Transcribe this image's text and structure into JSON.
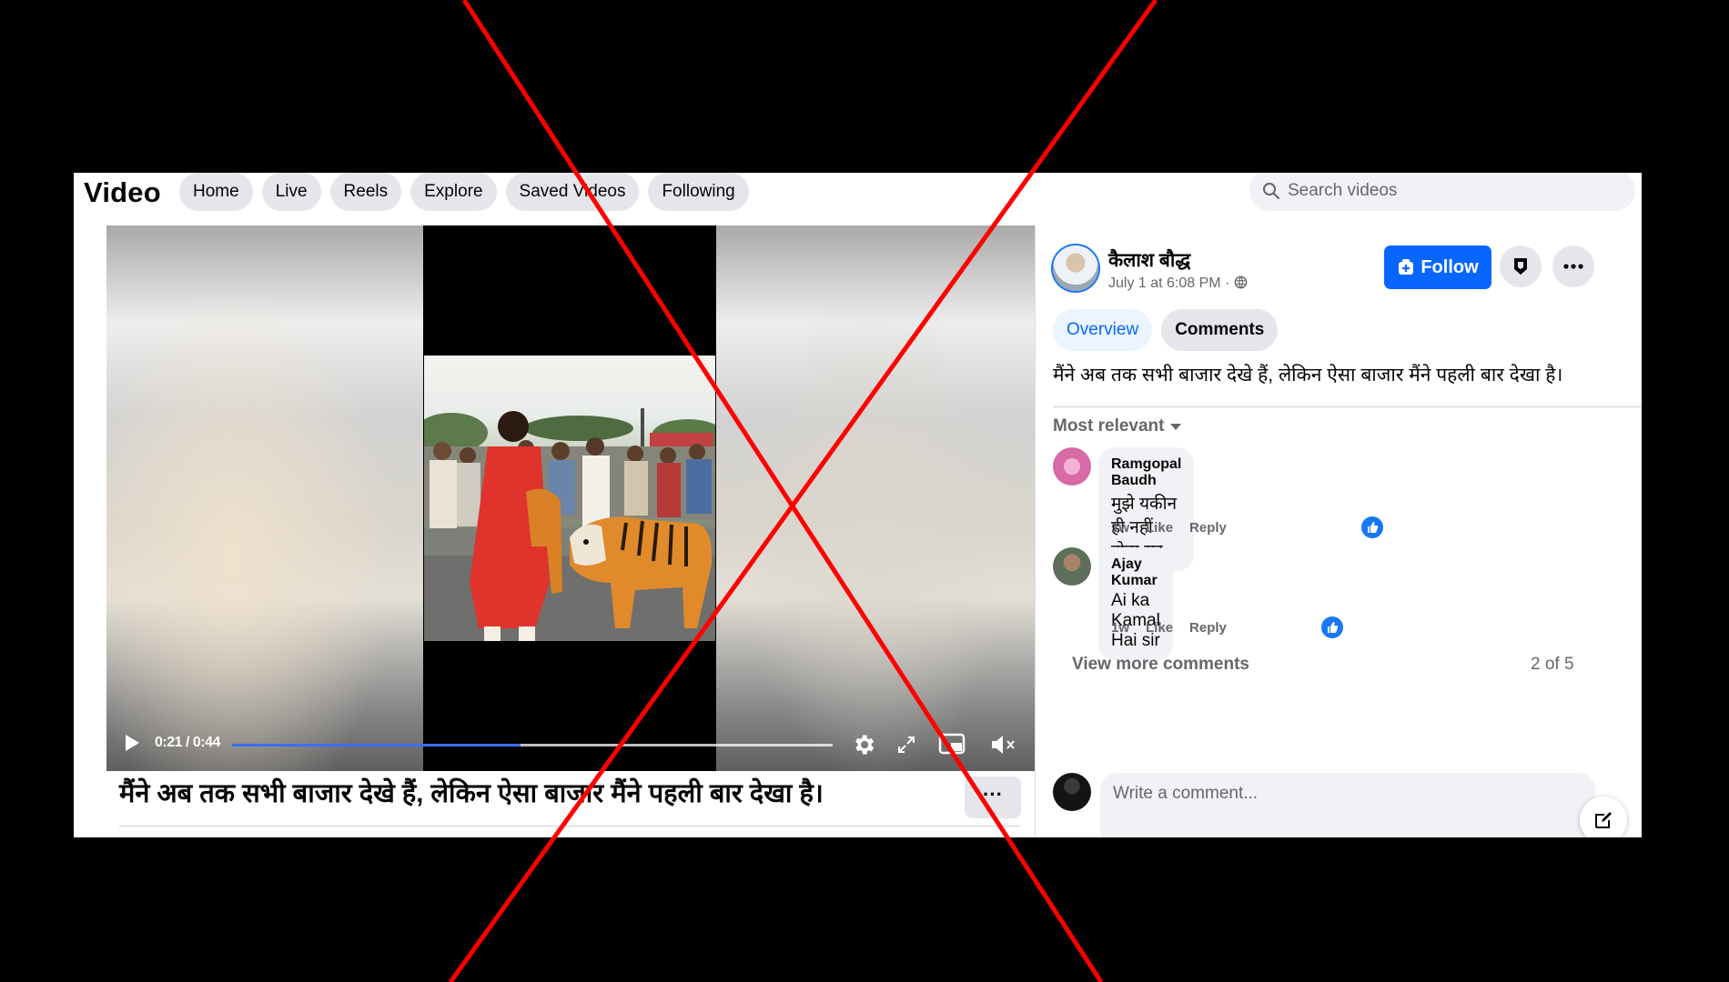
{
  "header": {
    "brand": "Video",
    "tabs": [
      "Home",
      "Live",
      "Reels",
      "Explore",
      "Saved Videos",
      "Following"
    ],
    "search_placeholder": "Search videos"
  },
  "player": {
    "time": "0:21 / 0:44",
    "progress": 0.48,
    "caption": "मैंने अब तक सभी बाजार देखे हैं, लेकिन ऐसा बाजार मैंने पहली बार देखा है।",
    "more": "···"
  },
  "post": {
    "author": "कैलाश बौद्ध",
    "timestamp": "July 1 at 6:08 PM · ",
    "follow_label": "Follow",
    "tabs": {
      "overview": "Overview",
      "comments": "Comments"
    },
    "description": "मैंने अब तक सभी बाजार देखे हैं, लेकिन ऐसा बाजार मैंने पहली बार देखा है।"
  },
  "comments": {
    "sort": "Most relevant",
    "items": [
      {
        "name": "Ramgopal Baudh",
        "text": "मुझे यकीन ही नहीं होता सर",
        "age": "1w",
        "like": "Like",
        "reply": "Reply"
      },
      {
        "name": "Ajay Kumar",
        "text": "Ai ka Kamal Hai sir",
        "age": "1w",
        "like": "Like",
        "reply": "Reply"
      }
    ],
    "view_more": "View more comments",
    "pager": "2 of 5",
    "write_placeholder": "Write a comment..."
  },
  "colors": {
    "accent": "#0866ff",
    "overlay_x": "#ff0000"
  },
  "icons": [
    "search-icon",
    "play-icon",
    "gear-icon",
    "fullscreen-icon",
    "pip-icon",
    "mute-icon",
    "shield-icon",
    "more-icon",
    "globe-icon",
    "caret-down-icon",
    "thumbs-up-icon",
    "compose-icon"
  ]
}
